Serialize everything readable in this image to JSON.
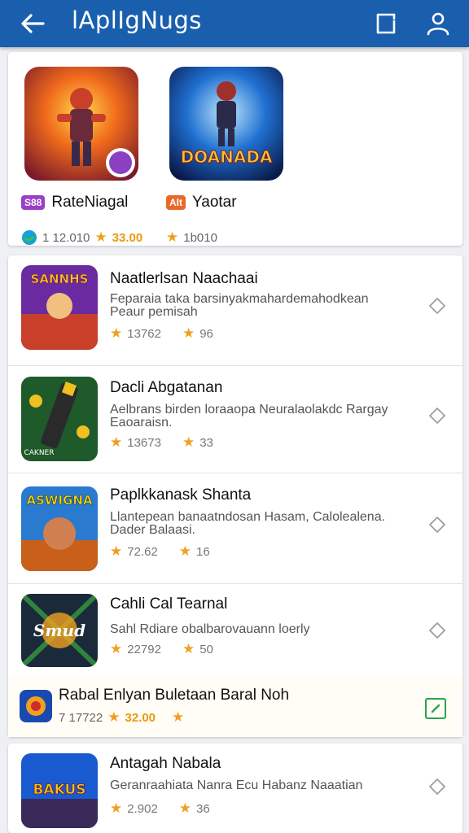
{
  "appbar": {
    "title": "lAplIgNugs",
    "icons": [
      "arrow-left-icon",
      "edit-note-icon",
      "user-icon"
    ]
  },
  "featured": [
    {
      "badge": "S88",
      "badge_color": "#9b3fc9",
      "name": "RateNiagal",
      "meta_num": "1 12.010",
      "price": "33.00"
    },
    {
      "badge": "Alt",
      "badge_color": "#e86a2a",
      "name": "Yaotar",
      "meta_num": "1b010",
      "art_text": "DOANADA"
    }
  ],
  "list": [
    {
      "title": "Naatlerlsan Naachaai",
      "desc": "Feparaia taka barsinyakmahardemahodkean Peaur pemisah",
      "rating": "13762",
      "count": "96",
      "art_text": "SANNHS"
    },
    {
      "title": "Dacli Abgatanan",
      "desc": "Aelbrans birden loraaopa Neuralaolakdc Rargay Eaoaraisn.",
      "rating": "13673",
      "count": "33",
      "art_text": "CAKNER"
    },
    {
      "title": "Paplkkanask Shanta",
      "desc": "Llantepean banaatndosan Hasam, Calolealena. Dader Balaasi.",
      "rating": "72.62",
      "count": "16",
      "art_text": "ASWIGNA"
    },
    {
      "title": "Cahli Cal Tearnal",
      "desc": "Sahl Rdiare obalbarovauann loerly",
      "rating": "22792",
      "count": "50",
      "art_text": "Smud"
    }
  ],
  "highlight": {
    "title": "Rabal Enlyan Buletaan Baral Noh",
    "meta_num": "7 17722",
    "price": "32.00"
  },
  "last": {
    "title": "Antagah Nabala",
    "desc": "Geranraahiata Nanra Ecu Habanz Naaatian",
    "rating": "2.902",
    "count": "36",
    "art_text": "BAKUS"
  },
  "colors": {
    "appbar": "#1a5fae",
    "star": "#f0a020",
    "price": "#e89a10",
    "check": "#2aa44a"
  }
}
